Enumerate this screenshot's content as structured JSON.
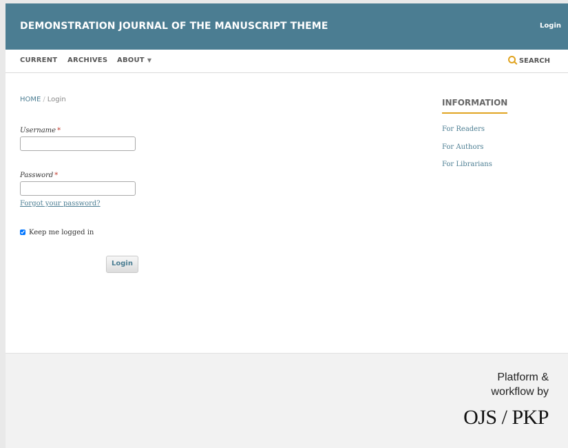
{
  "header": {
    "journal_title": "DEMONSTRATION JOURNAL OF THE MANUSCRIPT THEME",
    "login_label": "Login"
  },
  "nav": {
    "items": [
      {
        "label": "CURRENT"
      },
      {
        "label": "ARCHIVES"
      },
      {
        "label": "ABOUT"
      }
    ],
    "search_label": "SEARCH"
  },
  "breadcrumb": {
    "home": "HOME",
    "separator": "/",
    "current": "Login"
  },
  "form": {
    "username_label": "Username",
    "password_label": "Password",
    "required_marker": "*",
    "username_value": "",
    "password_value": "",
    "forgot_link": "Forgot your password?",
    "remember_label": "Keep me logged in",
    "submit_label": "Login"
  },
  "sidebar": {
    "title": "INFORMATION",
    "links": [
      {
        "label": "For Readers"
      },
      {
        "label": "For Authors"
      },
      {
        "label": "For Librarians"
      }
    ]
  },
  "footer": {
    "platform_line1": "Platform &",
    "platform_line2": "workflow by",
    "logo_text": "OJS / PKP"
  },
  "colors": {
    "header_bg": "#4b7d92",
    "accent": "#e0a31f",
    "link": "#4b7d92"
  },
  "icons": {
    "search": "search-icon",
    "caret": "chevron-down-icon"
  }
}
